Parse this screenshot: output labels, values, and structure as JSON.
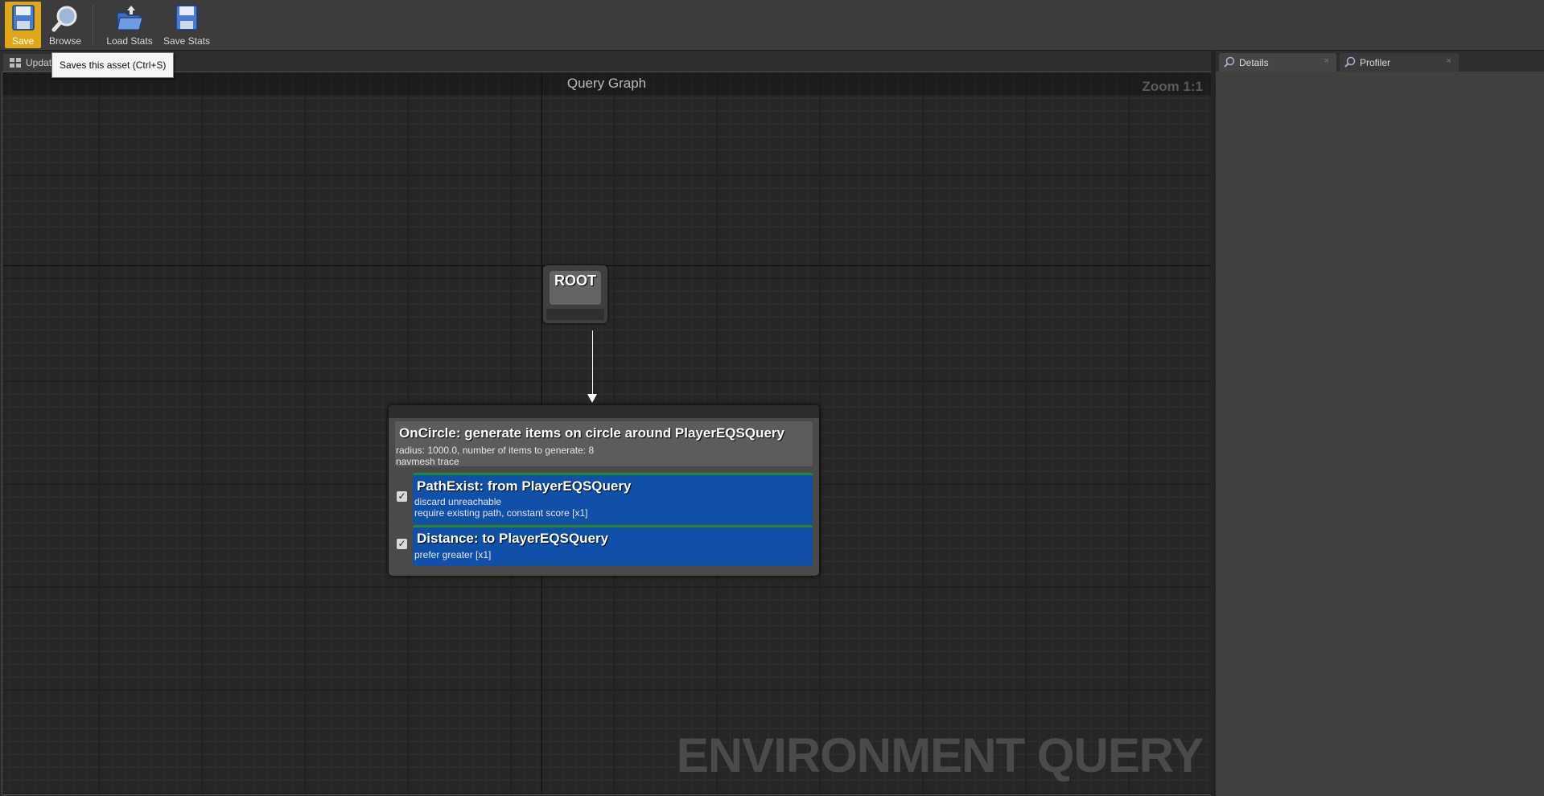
{
  "toolbar": {
    "save_label": "Save",
    "browse_label": "Browse",
    "load_stats_label": "Load Stats",
    "save_stats_label": "Save Stats"
  },
  "tabs": {
    "update_label": "Update",
    "details_label": "Details",
    "profiler_label": "Profiler",
    "close_glyph": "×"
  },
  "tooltip": {
    "text": "Saves this asset (Ctrl+S)"
  },
  "graph": {
    "title": "Query Graph",
    "zoom": "Zoom 1:1",
    "watermark": "ENVIRONMENT QUERY"
  },
  "nodes": {
    "root": {
      "label": "ROOT"
    },
    "generator": {
      "title": "OnCircle: generate items on circle around PlayerEQSQuery",
      "line1": "radius: 1000.0, number of items to generate: 8",
      "line2": "navmesh trace"
    },
    "tests": [
      {
        "title": "PathExist: from PlayerEQSQuery",
        "line1": "discard unreachable",
        "line2": "require existing path, constant score [x1]",
        "enabled": true
      },
      {
        "title": "Distance: to PlayerEQSQuery",
        "line1": "prefer greater [x1]",
        "enabled": true
      }
    ]
  },
  "colors": {
    "save_button": "#e0a818",
    "test_node": "#1050a8",
    "test_accent": "#1e8a3a"
  }
}
